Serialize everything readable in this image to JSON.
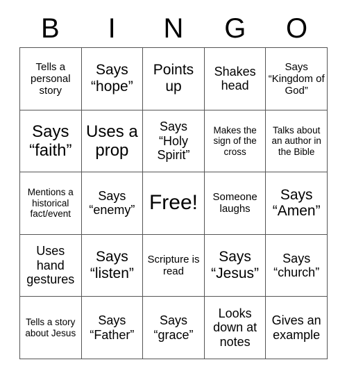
{
  "card": {
    "header": [
      "B",
      "I",
      "N",
      "G",
      "O"
    ],
    "colors": {
      "background": "#ffffff",
      "text": "#000000",
      "border": "#555555"
    },
    "rows": [
      [
        {
          "text": "Tells a personal story",
          "size": "s"
        },
        {
          "text": "Says “hope”",
          "size": "l"
        },
        {
          "text": "Points up",
          "size": "l"
        },
        {
          "text": "Shakes head",
          "size": "m"
        },
        {
          "text": "Says “Kingdom of God”",
          "size": "s"
        }
      ],
      [
        {
          "text": "Says “faith”",
          "size": "xl"
        },
        {
          "text": "Uses a prop",
          "size": "xl"
        },
        {
          "text": "Says “Holy Spirit”",
          "size": "m"
        },
        {
          "text": "Makes the sign of the cross",
          "size": "xs"
        },
        {
          "text": "Talks about an author in the Bible",
          "size": "xs"
        }
      ],
      [
        {
          "text": "Mentions a historical fact/event",
          "size": "xs"
        },
        {
          "text": "Says “enemy”",
          "size": "m"
        },
        {
          "text": "Free!",
          "size": "xxl"
        },
        {
          "text": "Someone laughs",
          "size": "s"
        },
        {
          "text": "Says “Amen”",
          "size": "l"
        }
      ],
      [
        {
          "text": "Uses hand gestures",
          "size": "m"
        },
        {
          "text": "Says “listen”",
          "size": "l"
        },
        {
          "text": "Scripture is read",
          "size": "s"
        },
        {
          "text": "Says “Jesus”",
          "size": "l"
        },
        {
          "text": "Says “church”",
          "size": "m"
        }
      ],
      [
        {
          "text": "Tells a story about Jesus",
          "size": "xs"
        },
        {
          "text": "Says “Father”",
          "size": "m"
        },
        {
          "text": "Says “grace”",
          "size": "m"
        },
        {
          "text": "Looks down at notes",
          "size": "m"
        },
        {
          "text": "Gives an example",
          "size": "m"
        }
      ]
    ]
  }
}
